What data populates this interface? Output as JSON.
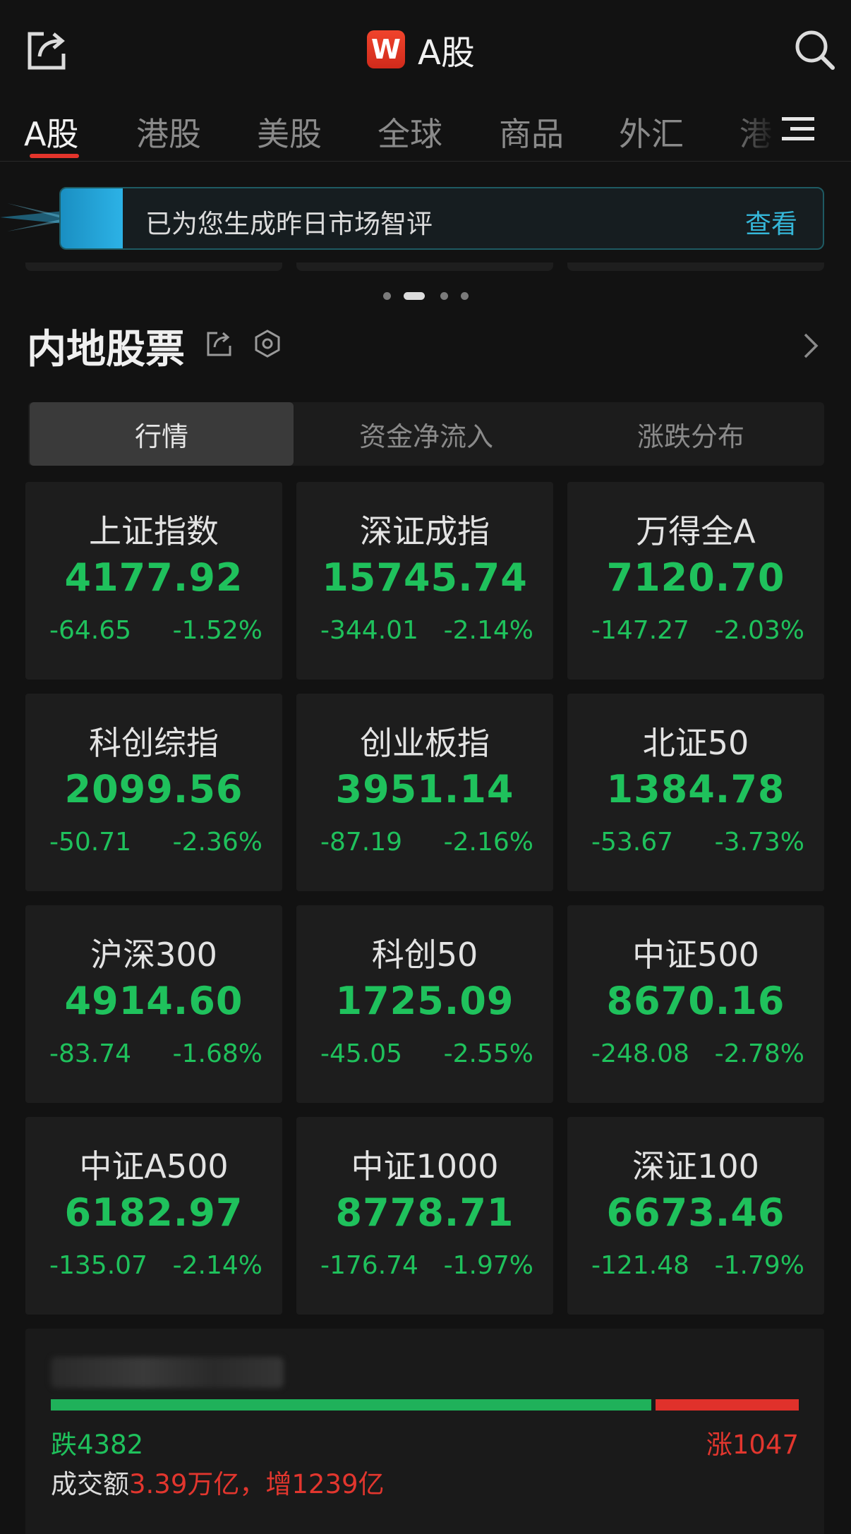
{
  "header": {
    "logo_letter": "W",
    "title": "A股",
    "share_icon": "share-export-icon",
    "search_icon": "search-icon"
  },
  "tabs": [
    {
      "label": "A股",
      "active": true
    },
    {
      "label": "港股",
      "active": false
    },
    {
      "label": "美股",
      "active": false
    },
    {
      "label": "全球",
      "active": false
    },
    {
      "label": "商品",
      "active": false
    },
    {
      "label": "外汇",
      "active": false
    },
    {
      "label": "港",
      "active": false
    }
  ],
  "tabs_menu_icon": "menu-icon",
  "banner": {
    "text": "已为您生成昨日市场智评",
    "link": "查看"
  },
  "carousel": {
    "count": 4,
    "active_index": 1
  },
  "section": {
    "title": "内地股票"
  },
  "segments": [
    {
      "label": "行情",
      "active": true
    },
    {
      "label": "资金净流入",
      "active": false
    },
    {
      "label": "涨跌分布",
      "active": false
    }
  ],
  "indices": [
    {
      "name": "上证指数",
      "price": "4177.92",
      "change": "-64.65",
      "pct": "-1.52%"
    },
    {
      "name": "深证成指",
      "price": "15745.74",
      "change": "-344.01",
      "pct": "-2.14%"
    },
    {
      "name": "万得全A",
      "price": "7120.70",
      "change": "-147.27",
      "pct": "-2.03%"
    },
    {
      "name": "科创综指",
      "price": "2099.56",
      "change": "-50.71",
      "pct": "-2.36%"
    },
    {
      "name": "创业板指",
      "price": "3951.14",
      "change": "-87.19",
      "pct": "-2.16%"
    },
    {
      "name": "北证50",
      "price": "1384.78",
      "change": "-53.67",
      "pct": "-3.73%"
    },
    {
      "name": "沪深300",
      "price": "4914.60",
      "change": "-83.74",
      "pct": "-1.68%"
    },
    {
      "name": "科创50",
      "price": "1725.09",
      "change": "-45.05",
      "pct": "-2.55%"
    },
    {
      "name": "中证500",
      "price": "8670.16",
      "change": "-248.08",
      "pct": "-2.78%"
    },
    {
      "name": "中证A500",
      "price": "6182.97",
      "change": "-135.07",
      "pct": "-2.14%"
    },
    {
      "name": "中证1000",
      "price": "8778.71",
      "change": "-176.74",
      "pct": "-1.97%"
    },
    {
      "name": "深证100",
      "price": "6673.46",
      "change": "-121.48",
      "pct": "-1.79%"
    }
  ],
  "breadth": {
    "fall_label": "跌4382",
    "rise_label": "涨1047",
    "fall_count": 4382,
    "rise_count": 1047,
    "turnover_prefix": "成交额",
    "turnover_value": "3.39万亿，增1239亿"
  },
  "colors": {
    "up": "#e2362e",
    "down": "#1fc15c",
    "accent": "#35b6d8",
    "brand": "#e3342b"
  }
}
